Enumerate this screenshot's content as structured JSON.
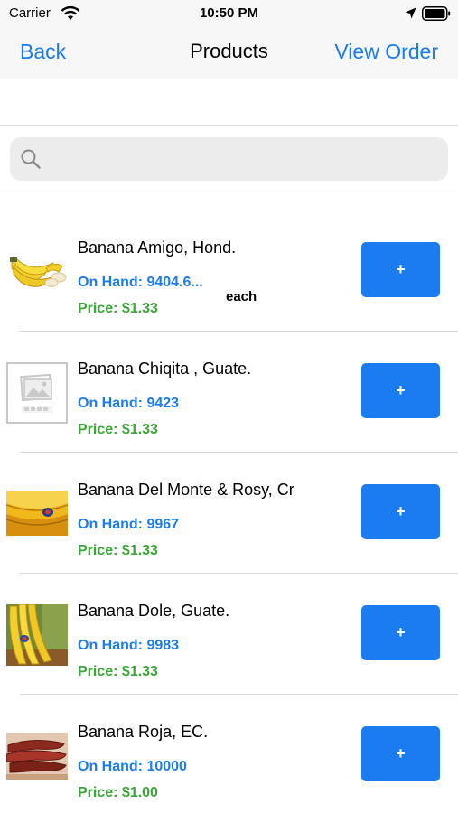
{
  "status_bar": {
    "carrier": "Carrier",
    "time": "10:50 PM"
  },
  "nav": {
    "back_label": "Back",
    "title": "Products",
    "view_order_label": "View Order"
  },
  "search": {
    "placeholder": "",
    "value": ""
  },
  "products": [
    {
      "name": "Banana Amigo, Hond.",
      "on_hand": "On Hand: 9404.6...",
      "unit": "each",
      "price": "Price: $1.33",
      "add_label": "+",
      "image": "bananas-bunch-photo"
    },
    {
      "name": "Banana Chiqita , Guate.",
      "on_hand": "On Hand: 9423",
      "price": "Price: $1.33",
      "add_label": "+",
      "image": "placeholder-image"
    },
    {
      "name": "Banana Del Monte & Rosy, Cr",
      "on_hand": "On Hand: 9967",
      "price": "Price: $1.33",
      "add_label": "+",
      "image": "banana-closeup-photo"
    },
    {
      "name": "Banana Dole, Guate.",
      "on_hand": "On Hand: 9983",
      "price": "Price: $1.33",
      "add_label": "+",
      "image": "dole-bananas-photo"
    },
    {
      "name": "Banana Roja, EC.",
      "on_hand": "On Hand: 10000",
      "price": "Price: $1.00",
      "add_label": "+",
      "image": "red-bananas-photo"
    }
  ],
  "colors": {
    "accent": "#1a7cf0",
    "price_green": "#3aa635",
    "nav_background": "#f7f7f7"
  }
}
